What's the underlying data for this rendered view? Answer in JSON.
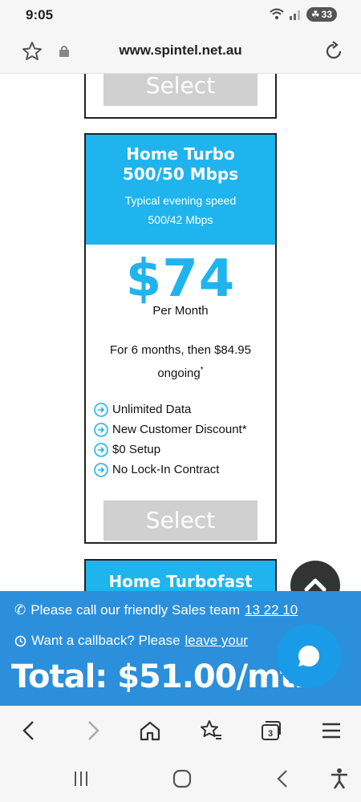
{
  "status_bar": {
    "time": "9:05",
    "battery": "33"
  },
  "browser": {
    "url": "www.spintel.net.au"
  },
  "prev_card": {
    "select_label": "Select"
  },
  "plan": {
    "title_line1": "Home Turbo",
    "title_line2": "500/50 Mbps",
    "speed_line1": "Typical evening speed",
    "speed_line2": "500/42 Mbps",
    "price": "$74",
    "per_month": "Per Month",
    "promo_line1": "For 6 months, then $84.95",
    "promo_line2": "ongoing",
    "promo_mark": "*",
    "features": [
      "Unlimited Data",
      "New Customer Discount*",
      "$0 Setup",
      "No Lock-In Contract"
    ],
    "select_label": "Select"
  },
  "next_plan": {
    "title": "Home Turbofast"
  },
  "sales": {
    "call_text": "Please call our friendly Sales team",
    "phone": "13 22 10",
    "callback_text": "Want a callback? Please",
    "callback_link": "leave your",
    "total": "Total: $51.00/mth"
  },
  "colors": {
    "brand": "#1fb4ee",
    "sales_bar": "#2b8fdb",
    "select_button": "#d0d0d0"
  }
}
